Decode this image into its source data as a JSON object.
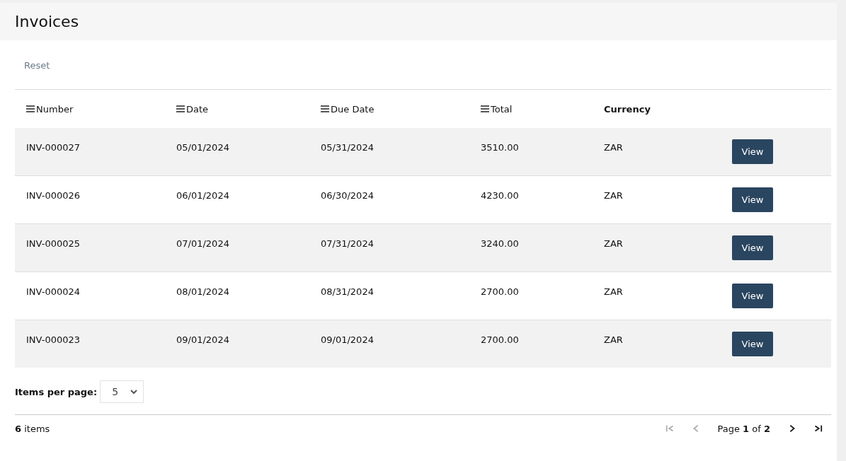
{
  "title": "Invoices",
  "reset": "Reset",
  "columns": [
    {
      "label": "Number",
      "sortable": true
    },
    {
      "label": "Date",
      "sortable": true
    },
    {
      "label": "Due Date",
      "sortable": true
    },
    {
      "label": "Total",
      "sortable": true
    },
    {
      "label": "Currency",
      "sortable": false
    }
  ],
  "rows": [
    {
      "cells": [
        "INV-000027",
        "05/01/2024",
        "05/31/2024",
        "3510.00",
        "ZAR"
      ],
      "action": "View"
    },
    {
      "cells": [
        "INV-000026",
        "06/01/2024",
        "06/30/2024",
        "4230.00",
        "ZAR"
      ],
      "action": "View"
    },
    {
      "cells": [
        "INV-000025",
        "07/01/2024",
        "07/31/2024",
        "3240.00",
        "ZAR"
      ],
      "action": "View"
    },
    {
      "cells": [
        "INV-000024",
        "08/01/2024",
        "08/31/2024",
        "2700.00",
        "ZAR"
      ],
      "action": "View"
    },
    {
      "cells": [
        "INV-000023",
        "09/01/2024",
        "09/01/2024",
        "2700.00",
        "ZAR"
      ],
      "action": "View"
    }
  ],
  "page_size": {
    "label": "Items per page:",
    "value": "5"
  },
  "item_count": "**6** items",
  "pager": {
    "first_disabled": true,
    "prev_disabled": true,
    "next_disabled": false,
    "last_disabled": false,
    "info": "Page **1** of **2**"
  }
}
